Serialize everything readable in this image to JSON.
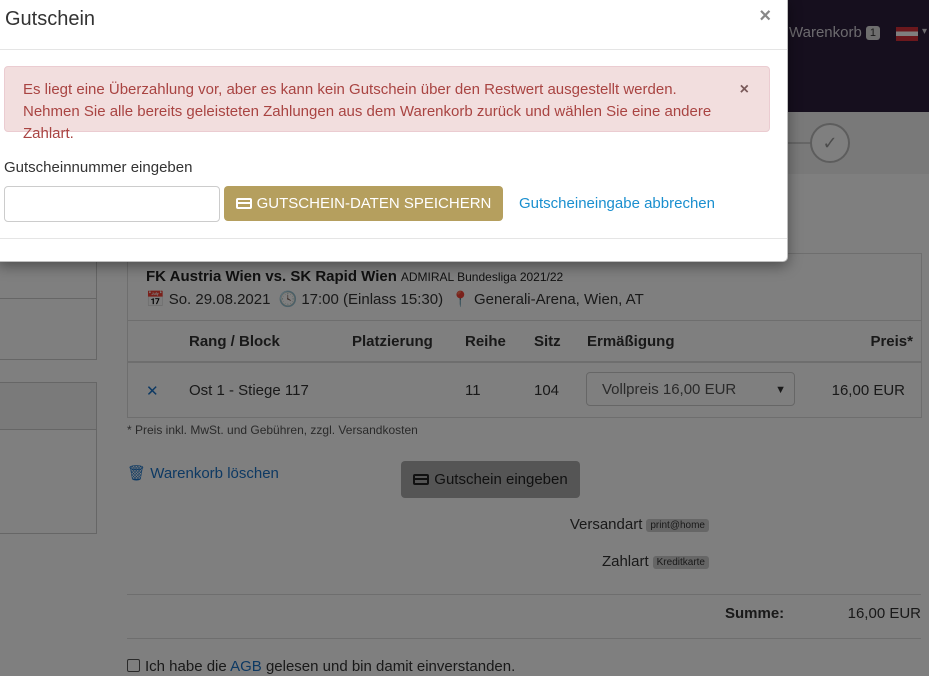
{
  "header": {
    "cart_label": "Warenkorb",
    "cart_count": "1"
  },
  "event": {
    "title": "FK Austria Wien vs. SK Rapid Wien",
    "league": "ADMIRAL Bundesliga 2021/22",
    "date": "So. 29.08.2021",
    "time": "17:00 (Einlass 15:30)",
    "venue": "Generali-Arena, Wien, AT"
  },
  "table": {
    "columns": [
      "Rang / Block",
      "Platzierung",
      "Reihe",
      "Sitz",
      "Ermäßigung",
      "Preis*"
    ],
    "rows": [
      {
        "rang_block": "Ost 1 - Stiege 117",
        "platzierung": "",
        "reihe": "11",
        "sitz": "104",
        "ermaessigung": "Vollpreis 16,00 EUR",
        "preis": "16,00 EUR"
      }
    ]
  },
  "footnote": "* Preis inkl. MwSt. und Gebühren, zzgl. Versandkosten",
  "cart_actions": {
    "clear_label": "Warenkorb löschen",
    "voucher_button": "Gutschein eingeben"
  },
  "shipping": {
    "label": "Versandart",
    "value": "print@home"
  },
  "payment": {
    "label": "Zahlart",
    "value": "Kreditkarte"
  },
  "summary": {
    "label": "Summe:",
    "value": "16,00 EUR"
  },
  "agb": {
    "prefix": "Ich habe die",
    "link": "AGB",
    "suffix": "gelesen und bin damit einverstanden."
  },
  "modal": {
    "title": "Gutschein",
    "close": "×",
    "alert_text": "Es liegt eine Überzahlung vor, aber es kann kein Gutschein über den Restwert ausgestellt werden. Nehmen Sie alle bereits geleisteten Zahlungen aus dem Warenkorb zurück und wählen Sie eine andere Zahlart.",
    "alert_close": "×",
    "input_label": "Gutscheinnummer eingeben",
    "input_value": "",
    "save_button": "GUTSCHEIN-DATEN SPEICHERN",
    "cancel_link": "Gutscheineingabe abbrechen"
  },
  "colors": {
    "topbar": "#2c1e3c",
    "save_button": "#b59f5e",
    "alert_bg": "#f2dede",
    "alert_text": "#a94442",
    "link": "#1a73c7"
  }
}
